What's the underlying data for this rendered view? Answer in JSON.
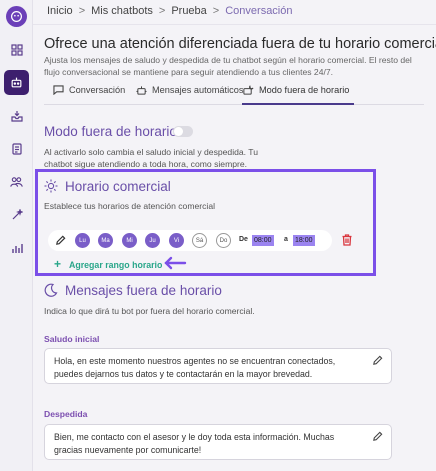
{
  "breadcrumb": [
    "Inicio",
    "Mis chatbots",
    "Prueba",
    "Conversación"
  ],
  "page": {
    "title": "Ofrece una atención diferenciada fuera de tu horario comercial",
    "subtitle": "Ajusta los mensajes de saludo y despedida de tu chatbot según el horario comercial. El resto del flujo conversacional se mantiene para seguir atendiendo a tus clientes 24/7."
  },
  "tabs": [
    {
      "label": "Conversación",
      "icon": "chat-icon",
      "active": false
    },
    {
      "label": "Mensajes automáticos",
      "icon": "robot-icon",
      "active": false
    },
    {
      "label": "Modo fuera de horario",
      "icon": "robot-moon-icon",
      "active": true
    }
  ],
  "after_hours": {
    "title": "Modo fuera de horario",
    "enabled": false,
    "description": "Al activarlo solo cambia el saludo inicial y despedida. Tu chatbot sigue atendiendo a toda hora, como siempre."
  },
  "business_hours": {
    "title": "Horario comercial",
    "description": "Establece tus horarios de atención comercial",
    "days": [
      {
        "label": "Lu",
        "on": true
      },
      {
        "label": "Ma",
        "on": true
      },
      {
        "label": "Mi",
        "on": true
      },
      {
        "label": "Ju",
        "on": true
      },
      {
        "label": "Vi",
        "on": true
      },
      {
        "label": "Sá",
        "on": false
      },
      {
        "label": "Do",
        "on": false
      }
    ],
    "from_label": "De",
    "from_time": "08:00",
    "to_label": "a",
    "to_time": "18:00",
    "add_range_label": "Agregar rango horario"
  },
  "messages": {
    "title": "Mensajes fuera de horario",
    "description": "Indica lo que dirá tu bot por fuera del horario comercial.",
    "greeting_label": "Saludo inicial",
    "greeting_text": "Hola, en este momento nuestros agentes no se encuentran conectados, puedes dejarnos tus datos y te contactarán en la mayor brevedad.",
    "farewell_label": "Despedida",
    "farewell_text": "Bien, me contacto con el asesor y le doy toda esta información. Muchas gracias nuevamente por comunicarte!"
  },
  "colors": {
    "accent": "#6a4fa8",
    "highlight": "#7b4fe8",
    "day_on": "#7a5ec8",
    "add_range": "#29a68a",
    "delete": "#d9363e"
  }
}
